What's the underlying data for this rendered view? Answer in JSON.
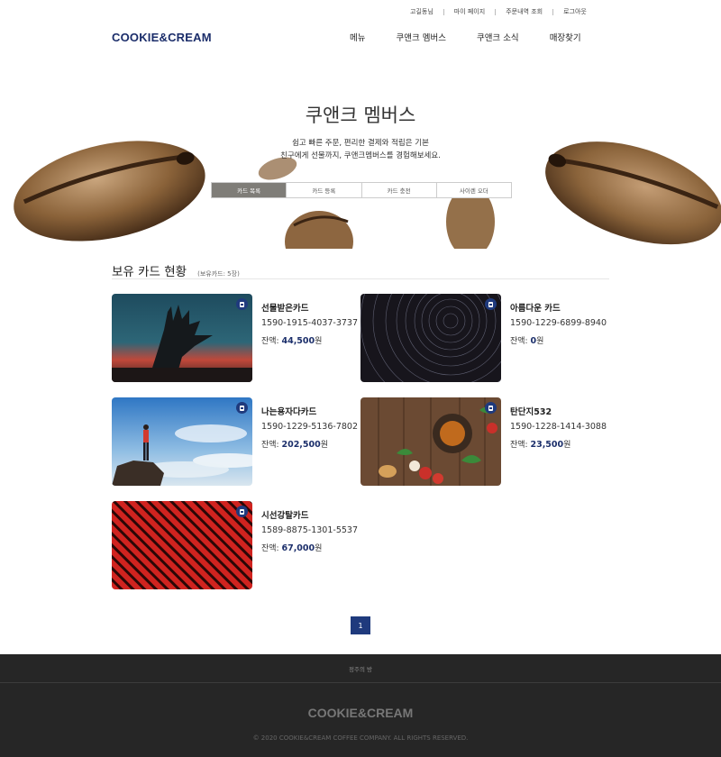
{
  "util_links": [
    "고길동님",
    "마이 페이지",
    "주문내역 조회",
    "로그아웃"
  ],
  "logo": "COOKIE&CREAM",
  "nav": [
    "메뉴",
    "쿠앤크 멤버스",
    "쿠앤크 소식",
    "매장찾기"
  ],
  "hero": {
    "title": "쿠앤크 멤버스",
    "desc_line1": "쉽고 빠른 주문, 편리한 결제와 적립은 기본",
    "desc_line2": "친구에게 선물까지, 쿠앤크멤버스를 경험해보세요.",
    "tabs": [
      "카드 목록",
      "카드 등록",
      "카드 충전",
      "사이렌 오더"
    ],
    "active_tab": "카드 목록"
  },
  "section": {
    "title": "보유 카드 현황",
    "count": "(보유카드: 5장)"
  },
  "cards": [
    {
      "name": "선물받은카드",
      "number": "1590-1915-4037-3737",
      "balance_label": "잔액:",
      "balance": "44,500",
      "unit": "원",
      "image": "hand-sunset-image"
    },
    {
      "name": "아름다운 카드",
      "number": "1590-1229-6899-8940",
      "balance_label": "잔액:",
      "balance": "0",
      "unit": "원",
      "image": "star-trails-image"
    },
    {
      "name": "나는용자다카드",
      "number": "1590-1229-5136-7802",
      "balance_label": "잔액:",
      "balance": "202,500",
      "unit": "원",
      "image": "hiker-cliff-image"
    },
    {
      "name": "탄단지532",
      "number": "1590-1228-1414-3088",
      "balance_label": "잔액:",
      "balance": "23,500",
      "unit": "원",
      "image": "food-table-image"
    },
    {
      "name": "시선강탈카드",
      "number": "1589-8875-1301-5537",
      "balance_label": "잔액:",
      "balance": "67,000",
      "unit": "원",
      "image": "red-stripes-image"
    }
  ],
  "pagination": {
    "current": "1"
  },
  "footer": {
    "policy": "정주의 방",
    "logo": "COOKIE&CREAM",
    "copyright": "© 2020 COOKIE&CREAM COFFEE COMPANY. ALL RIGHTS RESERVED."
  },
  "colors": {
    "brand": "#1b2d6a",
    "accent": "#1f3a7d",
    "footer_bg": "#262626"
  }
}
